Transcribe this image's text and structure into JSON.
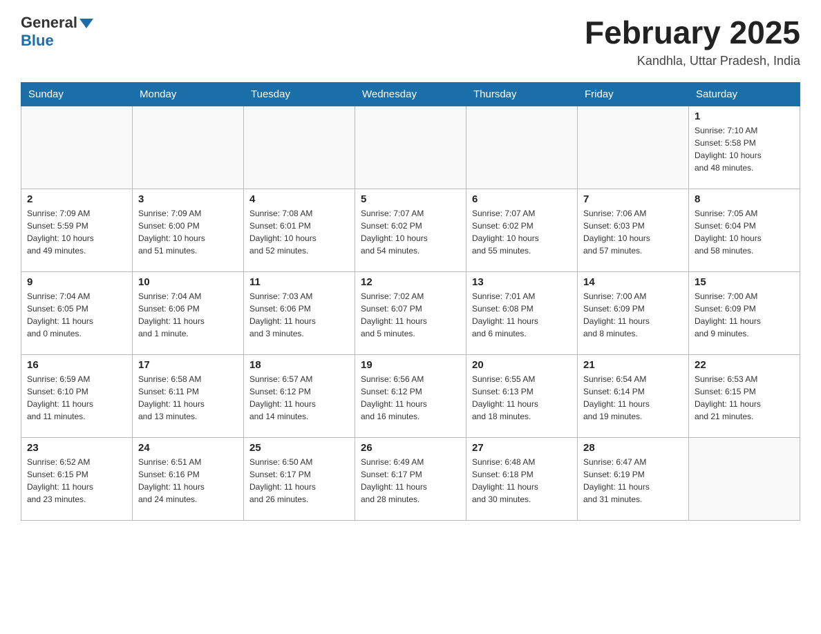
{
  "header": {
    "logo_general": "General",
    "logo_blue": "Blue",
    "month_title": "February 2025",
    "location": "Kandhla, Uttar Pradesh, India"
  },
  "days_of_week": [
    "Sunday",
    "Monday",
    "Tuesday",
    "Wednesday",
    "Thursday",
    "Friday",
    "Saturday"
  ],
  "weeks": [
    [
      {
        "day": "",
        "info": ""
      },
      {
        "day": "",
        "info": ""
      },
      {
        "day": "",
        "info": ""
      },
      {
        "day": "",
        "info": ""
      },
      {
        "day": "",
        "info": ""
      },
      {
        "day": "",
        "info": ""
      },
      {
        "day": "1",
        "info": "Sunrise: 7:10 AM\nSunset: 5:58 PM\nDaylight: 10 hours\nand 48 minutes."
      }
    ],
    [
      {
        "day": "2",
        "info": "Sunrise: 7:09 AM\nSunset: 5:59 PM\nDaylight: 10 hours\nand 49 minutes."
      },
      {
        "day": "3",
        "info": "Sunrise: 7:09 AM\nSunset: 6:00 PM\nDaylight: 10 hours\nand 51 minutes."
      },
      {
        "day": "4",
        "info": "Sunrise: 7:08 AM\nSunset: 6:01 PM\nDaylight: 10 hours\nand 52 minutes."
      },
      {
        "day": "5",
        "info": "Sunrise: 7:07 AM\nSunset: 6:02 PM\nDaylight: 10 hours\nand 54 minutes."
      },
      {
        "day": "6",
        "info": "Sunrise: 7:07 AM\nSunset: 6:02 PM\nDaylight: 10 hours\nand 55 minutes."
      },
      {
        "day": "7",
        "info": "Sunrise: 7:06 AM\nSunset: 6:03 PM\nDaylight: 10 hours\nand 57 minutes."
      },
      {
        "day": "8",
        "info": "Sunrise: 7:05 AM\nSunset: 6:04 PM\nDaylight: 10 hours\nand 58 minutes."
      }
    ],
    [
      {
        "day": "9",
        "info": "Sunrise: 7:04 AM\nSunset: 6:05 PM\nDaylight: 11 hours\nand 0 minutes."
      },
      {
        "day": "10",
        "info": "Sunrise: 7:04 AM\nSunset: 6:06 PM\nDaylight: 11 hours\nand 1 minute."
      },
      {
        "day": "11",
        "info": "Sunrise: 7:03 AM\nSunset: 6:06 PM\nDaylight: 11 hours\nand 3 minutes."
      },
      {
        "day": "12",
        "info": "Sunrise: 7:02 AM\nSunset: 6:07 PM\nDaylight: 11 hours\nand 5 minutes."
      },
      {
        "day": "13",
        "info": "Sunrise: 7:01 AM\nSunset: 6:08 PM\nDaylight: 11 hours\nand 6 minutes."
      },
      {
        "day": "14",
        "info": "Sunrise: 7:00 AM\nSunset: 6:09 PM\nDaylight: 11 hours\nand 8 minutes."
      },
      {
        "day": "15",
        "info": "Sunrise: 7:00 AM\nSunset: 6:09 PM\nDaylight: 11 hours\nand 9 minutes."
      }
    ],
    [
      {
        "day": "16",
        "info": "Sunrise: 6:59 AM\nSunset: 6:10 PM\nDaylight: 11 hours\nand 11 minutes."
      },
      {
        "day": "17",
        "info": "Sunrise: 6:58 AM\nSunset: 6:11 PM\nDaylight: 11 hours\nand 13 minutes."
      },
      {
        "day": "18",
        "info": "Sunrise: 6:57 AM\nSunset: 6:12 PM\nDaylight: 11 hours\nand 14 minutes."
      },
      {
        "day": "19",
        "info": "Sunrise: 6:56 AM\nSunset: 6:12 PM\nDaylight: 11 hours\nand 16 minutes."
      },
      {
        "day": "20",
        "info": "Sunrise: 6:55 AM\nSunset: 6:13 PM\nDaylight: 11 hours\nand 18 minutes."
      },
      {
        "day": "21",
        "info": "Sunrise: 6:54 AM\nSunset: 6:14 PM\nDaylight: 11 hours\nand 19 minutes."
      },
      {
        "day": "22",
        "info": "Sunrise: 6:53 AM\nSunset: 6:15 PM\nDaylight: 11 hours\nand 21 minutes."
      }
    ],
    [
      {
        "day": "23",
        "info": "Sunrise: 6:52 AM\nSunset: 6:15 PM\nDaylight: 11 hours\nand 23 minutes."
      },
      {
        "day": "24",
        "info": "Sunrise: 6:51 AM\nSunset: 6:16 PM\nDaylight: 11 hours\nand 24 minutes."
      },
      {
        "day": "25",
        "info": "Sunrise: 6:50 AM\nSunset: 6:17 PM\nDaylight: 11 hours\nand 26 minutes."
      },
      {
        "day": "26",
        "info": "Sunrise: 6:49 AM\nSunset: 6:17 PM\nDaylight: 11 hours\nand 28 minutes."
      },
      {
        "day": "27",
        "info": "Sunrise: 6:48 AM\nSunset: 6:18 PM\nDaylight: 11 hours\nand 30 minutes."
      },
      {
        "day": "28",
        "info": "Sunrise: 6:47 AM\nSunset: 6:19 PM\nDaylight: 11 hours\nand 31 minutes."
      },
      {
        "day": "",
        "info": ""
      }
    ]
  ]
}
